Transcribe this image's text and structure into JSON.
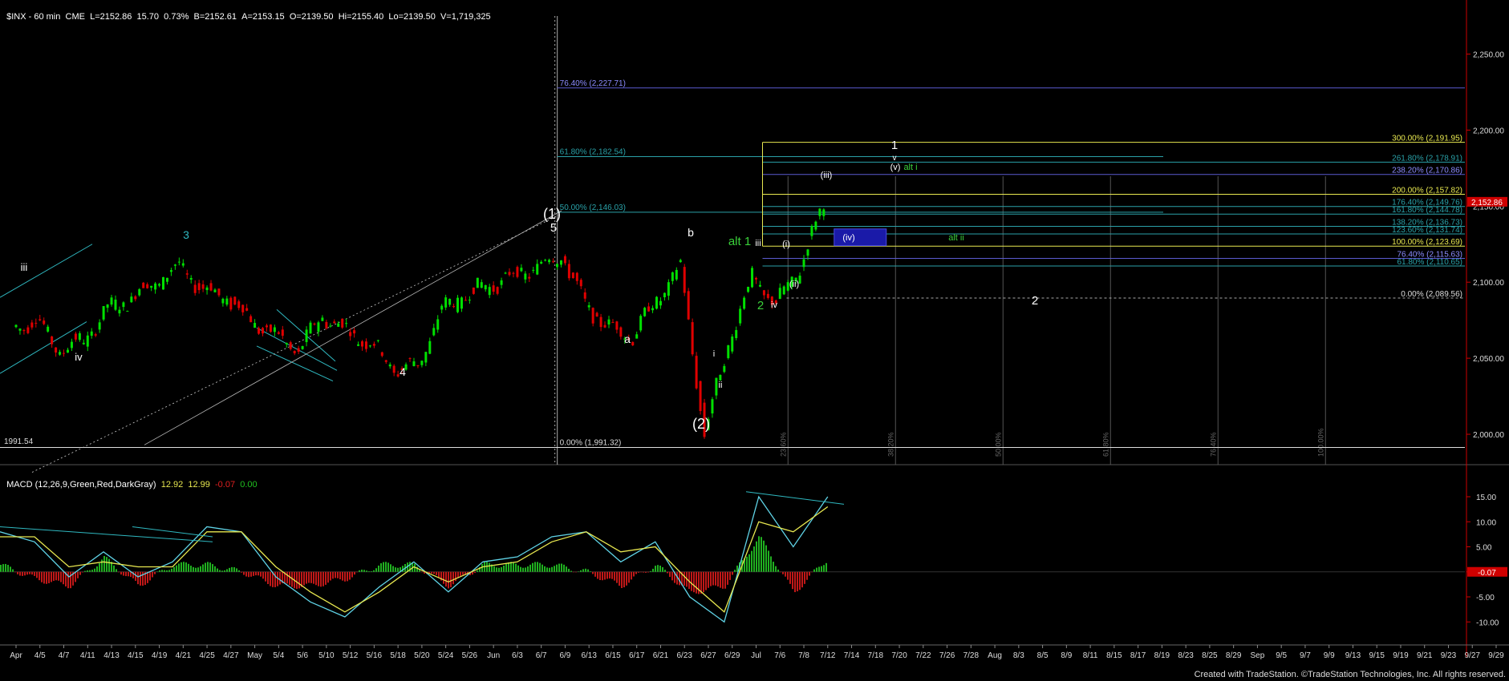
{
  "header": {
    "symbol": "$INX - 60 min",
    "exchange": "CME",
    "last": "L=2152.86",
    "change": "15.70",
    "change_pct": "0.73%",
    "bid": "B=2152.61",
    "ask": "A=2153.15",
    "open": "O=2139.50",
    "high": "Hi=2155.40",
    "low": "Lo=2139.50",
    "volume": "V=1,719,325"
  },
  "macd_header": {
    "label": "MACD (12,26,9,Green,Red,DarkGray)",
    "macd": "12.92",
    "signal": "12.99",
    "hist": "-0.07",
    "zero": "0.00"
  },
  "credit": "Created with TradeStation. ©TradeStation Technologies, Inc. All rights reserved.",
  "colors": {
    "background": "#000000",
    "up_bar": "#00e000",
    "down_bar": "#e00000",
    "trend_cyan": "#2fb8c0",
    "fib_blue": "#5b5bd0",
    "fib_teal": "#2aa1a8",
    "fib_yellow": "#e8e850",
    "macd_line": "#5fd3e6",
    "signal_line": "#e8e850",
    "price_tag": "#d00000",
    "wave_green": "#3ad03a"
  },
  "chart_data": [
    {
      "type": "candlestick",
      "title": "$INX - 60 min",
      "x_ticks": [
        "Apr",
        "4/5",
        "4/7",
        "4/11",
        "4/13",
        "4/15",
        "4/19",
        "4/21",
        "4/25",
        "4/27",
        "May",
        "5/4",
        "5/6",
        "5/10",
        "5/12",
        "5/16",
        "5/18",
        "5/20",
        "5/24",
        "5/26",
        "Jun",
        "6/3",
        "6/7",
        "6/9",
        "6/13",
        "6/15",
        "6/17",
        "6/21",
        "6/23",
        "6/27",
        "6/29",
        "Jul",
        "7/6",
        "7/8",
        "7/12",
        "7/14",
        "7/18",
        "7/20",
        "7/22",
        "7/26",
        "7/28",
        "Aug",
        "8/3",
        "8/5",
        "8/9",
        "8/11",
        "8/15",
        "8/17",
        "8/19",
        "8/23",
        "8/25",
        "8/29",
        "Sep",
        "9/5",
        "9/7",
        "9/9",
        "9/13",
        "9/15",
        "9/19",
        "9/21",
        "9/23",
        "9/27",
        "9/29"
      ],
      "y_ticks": [
        "2,250.00",
        "2,200.00",
        "2,150.00",
        "2,100.00",
        "2,050.00",
        "2,000.00"
      ],
      "ylim": [
        1980,
        2275
      ],
      "last_price_tag": "2,152.86",
      "price_path": [
        {
          "x": "Apr",
          "y": 2070
        },
        {
          "x": "4/5",
          "y": 2075
        },
        {
          "x": "4/7",
          "y": 2055
        },
        {
          "x": "4/11",
          "y": 2062
        },
        {
          "x": "4/13",
          "y": 2082
        },
        {
          "x": "4/15",
          "y": 2090
        },
        {
          "x": "4/19",
          "y": 2100
        },
        {
          "x": "4/21",
          "y": 2110
        },
        {
          "x": "4/25",
          "y": 2095
        },
        {
          "x": "4/27",
          "y": 2090
        },
        {
          "x": "May",
          "y": 2075
        },
        {
          "x": "5/4",
          "y": 2065
        },
        {
          "x": "5/6",
          "y": 2055
        },
        {
          "x": "5/10",
          "y": 2078
        },
        {
          "x": "5/12",
          "y": 2068
        },
        {
          "x": "5/16",
          "y": 2060
        },
        {
          "x": "5/18",
          "y": 2043
        },
        {
          "x": "5/20",
          "y": 2045
        },
        {
          "x": "5/24",
          "y": 2082
        },
        {
          "x": "5/26",
          "y": 2092
        },
        {
          "x": "Jun",
          "y": 2098
        },
        {
          "x": "6/3",
          "y": 2104
        },
        {
          "x": "6/7",
          "y": 2110
        },
        {
          "x": "6/9",
          "y": 2118
        },
        {
          "x": "6/13",
          "y": 2085
        },
        {
          "x": "6/15",
          "y": 2070
        },
        {
          "x": "6/17",
          "y": 2065
        },
        {
          "x": "6/21",
          "y": 2088
        },
        {
          "x": "6/23",
          "y": 2110
        },
        {
          "x": "6/27",
          "y": 2000
        },
        {
          "x": "6/29",
          "y": 2060
        },
        {
          "x": "Jul",
          "y": 2103
        },
        {
          "x": "7/6",
          "y": 2085
        },
        {
          "x": "7/8",
          "y": 2110
        },
        {
          "x": "7/12",
          "y": 2152
        }
      ],
      "fib_left": [
        {
          "label": "76.40% (2,227.71)",
          "y": 2227.71
        },
        {
          "label": "61.80% (2,182.54)",
          "y": 2182.54
        },
        {
          "label": "50.00% (2,146.03)",
          "y": 2146.03
        },
        {
          "label": "0.00% (1,991.32)",
          "y": 1991.32
        }
      ],
      "fib_right": [
        {
          "label": "300.00% (2,191.95)",
          "y": 2191.95
        },
        {
          "label": "261.80% (2,178.91)",
          "y": 2178.91
        },
        {
          "label": "238.20% (2,170.86)",
          "y": 2170.86
        },
        {
          "label": "200.00% (2,157.82)",
          "y": 2157.82
        },
        {
          "label": "176.40% (2,149.76)",
          "y": 2149.76
        },
        {
          "label": "161.80% (2,144.78)",
          "y": 2144.78
        },
        {
          "label": "138.20% (2,136.73)",
          "y": 2136.73
        },
        {
          "label": "123.60% (2,131.74)",
          "y": 2131.74
        },
        {
          "label": "100.00% (2,123.69)",
          "y": 2123.69
        },
        {
          "label": "76.40% (2,115.63)",
          "y": 2115.63
        },
        {
          "label": "61.80% (2,110.65)",
          "y": 2110.65
        },
        {
          "label": "0.00% (2,089.56)",
          "y": 2089.56
        }
      ],
      "time_fibs": [
        "23.60%",
        "38.20%",
        "50.00%",
        "61.80%",
        "76.40%",
        "100.00%"
      ],
      "low_label": "1991.54",
      "wave_labels": [
        {
          "text": "iii",
          "color": "white"
        },
        {
          "text": "iv",
          "color": "white"
        },
        {
          "text": "3",
          "color": "cyan"
        },
        {
          "text": "4",
          "color": "white"
        },
        {
          "text": "(1)",
          "color": "white"
        },
        {
          "text": "5",
          "color": "white"
        },
        {
          "text": "a",
          "color": "white"
        },
        {
          "text": "b",
          "color": "white"
        },
        {
          "text": "(2)",
          "color": "white"
        },
        {
          "text": "i",
          "color": "white"
        },
        {
          "text": "ii",
          "color": "white"
        },
        {
          "text": "alt 1",
          "color": "green"
        },
        {
          "text": "iii",
          "color": "white"
        },
        {
          "text": "2",
          "color": "green"
        },
        {
          "text": "iv",
          "color": "white"
        },
        {
          "text": "(i)",
          "color": "white"
        },
        {
          "text": "(ii)",
          "color": "white"
        },
        {
          "text": "(iii)",
          "color": "white"
        },
        {
          "text": "(iv)",
          "color": "white"
        },
        {
          "text": "alt ii",
          "color": "green"
        },
        {
          "text": "1",
          "color": "white"
        },
        {
          "text": "v",
          "color": "white"
        },
        {
          "text": "(v)",
          "color": "white"
        },
        {
          "text": "alt i",
          "color": "green"
        },
        {
          "text": "2",
          "color": "white"
        }
      ]
    },
    {
      "type": "line",
      "title": "MACD (12,26,9,Green,Red,DarkGray)",
      "y_ticks": [
        "15.00",
        "10.00",
        "5.00",
        "0.00",
        "-5.00",
        "-10.00"
      ],
      "ylim": [
        -13,
        19
      ],
      "last_value_tag": "-0.07",
      "series": [
        {
          "name": "MACD",
          "values": [
            8,
            6,
            -1,
            4,
            -1,
            2,
            9,
            8,
            -1,
            -6,
            -9,
            -3,
            2,
            -4,
            2,
            3,
            7,
            8,
            2,
            6,
            -5,
            -10,
            15,
            5,
            15
          ]
        },
        {
          "name": "Signal",
          "values": [
            7,
            7,
            1,
            2,
            1,
            1,
            8,
            8,
            1,
            -4,
            -8,
            -4,
            1,
            -2,
            1,
            2,
            6,
            8,
            4,
            5,
            -2,
            -8,
            10,
            8,
            13
          ]
        }
      ]
    }
  ]
}
